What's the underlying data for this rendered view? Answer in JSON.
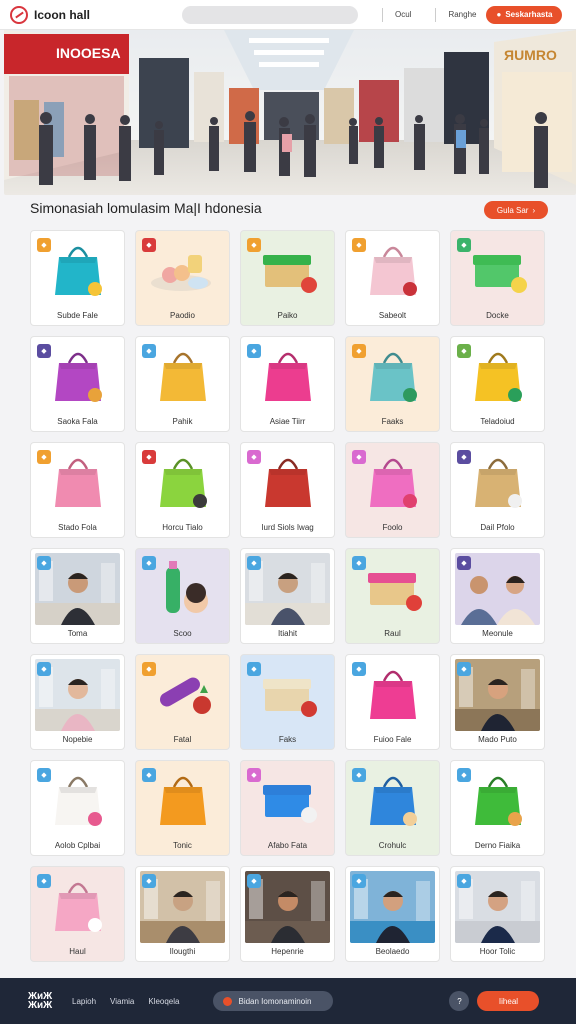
{
  "header": {
    "logo_text": "Icoon hall",
    "search_placeholder": "",
    "link_1": "Ocul",
    "link_2": "Ranghe",
    "cta_label": "Seskarhasta"
  },
  "hero": {
    "store_sign_left": "INOOESA",
    "store_sign_right": "ЯUMRO"
  },
  "section": {
    "title": "Simonasiah lomulasim Ma|I hdonesia",
    "see_all_label": "Gula Sar"
  },
  "colors": {
    "accent": "#e8502a",
    "footer": "#1f2738"
  },
  "items": [
    {
      "label": "Subde Fale",
      "badge_color": "#f0a030",
      "icon": "blue-gift-bag",
      "tint": "white"
    },
    {
      "label": "Paodio",
      "badge_color": "#d93b3b",
      "icon": "dessert-plate",
      "tint": "cream"
    },
    {
      "label": "Paiko",
      "badge_color": "#f0a030",
      "icon": "gift-box",
      "tint": "mint"
    },
    {
      "label": "Sabeolt",
      "badge_color": "#f0a030",
      "icon": "pink-tote-bag",
      "tint": "white"
    },
    {
      "label": "Docke",
      "badge_color": "#3bb36b",
      "icon": "green-gift-box",
      "tint": "pink"
    },
    {
      "label": "Saoka Fala",
      "badge_color": "#5b4da0",
      "icon": "purple-gift-bag",
      "tint": "white"
    },
    {
      "label": "Pahik",
      "badge_color": "#4aa6e0",
      "icon": "yellow-tote-bag",
      "tint": "white"
    },
    {
      "label": "Asiae Tiirr",
      "badge_color": "#4aa6e0",
      "icon": "magenta-tote-bag",
      "tint": "white"
    },
    {
      "label": "Faaks",
      "badge_color": "#f0a030",
      "icon": "teal-tote-bag",
      "tint": "cream"
    },
    {
      "label": "Teladoiud",
      "badge_color": "#6bb04a",
      "icon": "yellow-gift-bag",
      "tint": "white"
    },
    {
      "label": "Stado Fola",
      "badge_color": "#f0a030",
      "icon": "pink-gift-bag",
      "tint": "white"
    },
    {
      "label": "Horcu Tialo",
      "badge_color": "#d93b3b",
      "icon": "lime-gift-bag",
      "tint": "white"
    },
    {
      "label": "Iurd Siols Iwag",
      "badge_color": "#d96ad0",
      "icon": "red-tote-bag",
      "tint": "white"
    },
    {
      "label": "Foolo",
      "badge_color": "#d96ad0",
      "icon": "pink-gift-bag-heart",
      "tint": "pink"
    },
    {
      "label": "Dail Pfolo",
      "badge_color": "#5b4da0",
      "icon": "woven-tote-bag",
      "tint": "white"
    },
    {
      "label": "Toma",
      "badge_color": "#4aa6e0",
      "icon": "photo-man-mall",
      "tint": "white"
    },
    {
      "label": "Scoo",
      "badge_color": "#4aa6e0",
      "icon": "bottle-figurine",
      "tint": "lav"
    },
    {
      "label": "Itiahit",
      "badge_color": "#4aa6e0",
      "icon": "photo-mall-crowd",
      "tint": "white"
    },
    {
      "label": "Raul",
      "badge_color": "#4aa6e0",
      "icon": "pink-gift-box",
      "tint": "mint"
    },
    {
      "label": "Meonule",
      "badge_color": "#5b4da0",
      "icon": "photo-couple",
      "tint": "white"
    },
    {
      "label": "Nopebie",
      "badge_color": "#4aa6e0",
      "icon": "photo-woman-mall",
      "tint": "white"
    },
    {
      "label": "Fatal",
      "badge_color": "#f0a030",
      "icon": "purple-bottle",
      "tint": "cream"
    },
    {
      "label": "Faks",
      "badge_color": "#4aa6e0",
      "icon": "cream-gift-box",
      "tint": "blue"
    },
    {
      "label": "Fuioo Fale",
      "badge_color": "#4aa6e0",
      "icon": "magenta-tote-bag-2",
      "tint": "white"
    },
    {
      "label": "Mado Puto",
      "badge_color": "#4aa6e0",
      "icon": "photo-man-suit",
      "tint": "white"
    },
    {
      "label": "Aolob Cplbai",
      "badge_color": "#4aa6e0",
      "icon": "white-gift-bag",
      "tint": "white"
    },
    {
      "label": "Tonic",
      "badge_color": "#4aa6e0",
      "icon": "orange-gift-bag",
      "tint": "cream"
    },
    {
      "label": "Afabo Fata",
      "badge_color": "#d96ad0",
      "icon": "blue-gift-box",
      "tint": "pink"
    },
    {
      "label": "Crohulc",
      "badge_color": "#4aa6e0",
      "icon": "blue-gift-bag-2",
      "tint": "mint"
    },
    {
      "label": "Derno Fiaika",
      "badge_color": "#4aa6e0",
      "icon": "green-gift-bag",
      "tint": "white"
    },
    {
      "label": "Haul",
      "badge_color": "#4aa6e0",
      "icon": "pink-tote-bag-2",
      "tint": "pink"
    },
    {
      "label": "Ilougthi",
      "badge_color": "#4aa6e0",
      "icon": "photo-mall-corridor",
      "tint": "white"
    },
    {
      "label": "Hepenrie",
      "badge_color": "#4aa6e0",
      "icon": "photo-man-eating",
      "tint": "white"
    },
    {
      "label": "Beolaedo",
      "badge_color": "#4aa6e0",
      "icon": "photo-man-harbor",
      "tint": "white"
    },
    {
      "label": "Hoor Tolic",
      "badge_color": "#4aa6e0",
      "icon": "photo-man-suit-2",
      "tint": "white"
    }
  ],
  "footer": {
    "logo_line_1": "ЖᴎЖ",
    "logo_line_2": "ЖᴎЖ",
    "link_1": "Lapioh",
    "link_2": "Viamia",
    "link_3": "Kleoqela",
    "pill_label": "Bidan Iomonaminoin",
    "circle_label": "?",
    "cta_label": "Iiheal"
  }
}
